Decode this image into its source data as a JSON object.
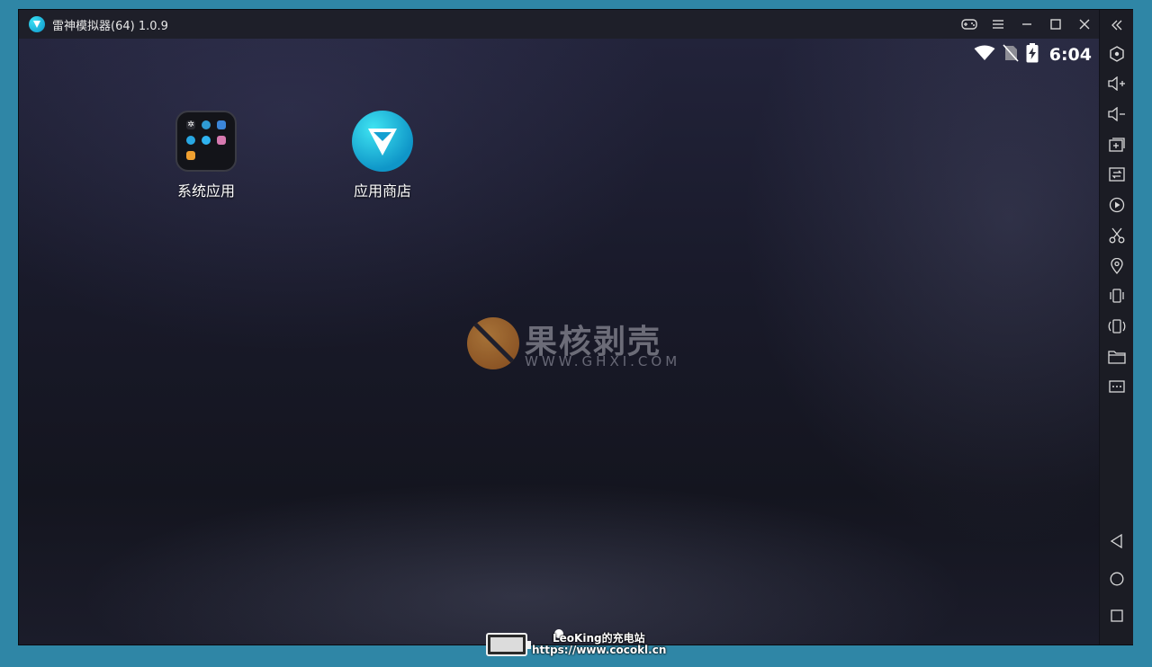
{
  "window": {
    "title": "雷神模拟器(64) 1.0.9",
    "icons": {
      "gamepad": "gamepad-icon",
      "menu": "menu-icon",
      "minimize": "minimize-icon",
      "maximize": "maximize-icon",
      "close": "close-icon"
    }
  },
  "status_bar": {
    "time": "6:04",
    "icons": [
      "wifi-icon",
      "no-sim-icon",
      "battery-charging-icon"
    ]
  },
  "desktop": {
    "icons": [
      {
        "label": "系统应用",
        "icon": "folder-icon"
      },
      {
        "label": "应用商店",
        "icon": "app-store-icon"
      }
    ]
  },
  "watermark": {
    "title": "果核剥壳",
    "subtitle": "WWW.GHXI.COM"
  },
  "sidebar": {
    "tools": [
      "collapse-icon",
      "settings-hex-icon",
      "volume-up-icon",
      "volume-down-icon",
      "add-window-icon",
      "sync-icon",
      "record-icon",
      "scissors-icon",
      "location-icon",
      "shake-icon",
      "rotate-icon",
      "folder-icon",
      "more-icon"
    ],
    "nav": [
      "back-icon",
      "home-icon",
      "recents-icon"
    ]
  },
  "overlay": {
    "name": "LeoKing的充电站",
    "url": "https://www.cocokl.cn"
  },
  "colors": {
    "background": "#2f86a6",
    "titlebar": "#1e1f29",
    "sidebar": "#1b1c24",
    "accent": "#1aa8d8"
  }
}
